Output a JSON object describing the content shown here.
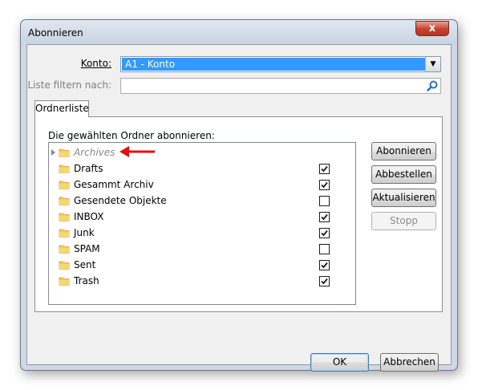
{
  "window": {
    "title": "Abonnieren",
    "close_glyph": "x"
  },
  "form": {
    "konto_label": "Konto:",
    "konto_value": "A1 - Konto",
    "filter_label": "Liste filtern nach:",
    "filter_value": "",
    "filter_placeholder": ""
  },
  "tabs": [
    {
      "label": "Ordnerliste",
      "active": true
    }
  ],
  "panel": {
    "label": "Die gewählten Ordner abonnieren:",
    "folders": [
      {
        "name": "Archives",
        "checked": null,
        "disabled": true,
        "expandable": true
      },
      {
        "name": "Drafts",
        "checked": true
      },
      {
        "name": "Gesammt Archiv",
        "checked": true
      },
      {
        "name": "Gesendete Objekte",
        "checked": false
      },
      {
        "name": "INBOX",
        "checked": true
      },
      {
        "name": "Junk",
        "checked": true
      },
      {
        "name": "SPAM",
        "checked": false
      },
      {
        "name": "Sent",
        "checked": true
      },
      {
        "name": "Trash",
        "checked": true
      }
    ]
  },
  "side_buttons": [
    {
      "label": "Abonnieren",
      "enabled": true
    },
    {
      "label": "Abbestellen",
      "enabled": true
    },
    {
      "label": "Aktualisieren",
      "enabled": true
    },
    {
      "label": "Stopp",
      "enabled": false
    }
  ],
  "footer": {
    "ok_label": "OK",
    "cancel_label": "Abbrechen"
  },
  "colors": {
    "selection": "#3399ff",
    "arrow_annotation": "#e01010",
    "folder": "#f2c94c"
  }
}
